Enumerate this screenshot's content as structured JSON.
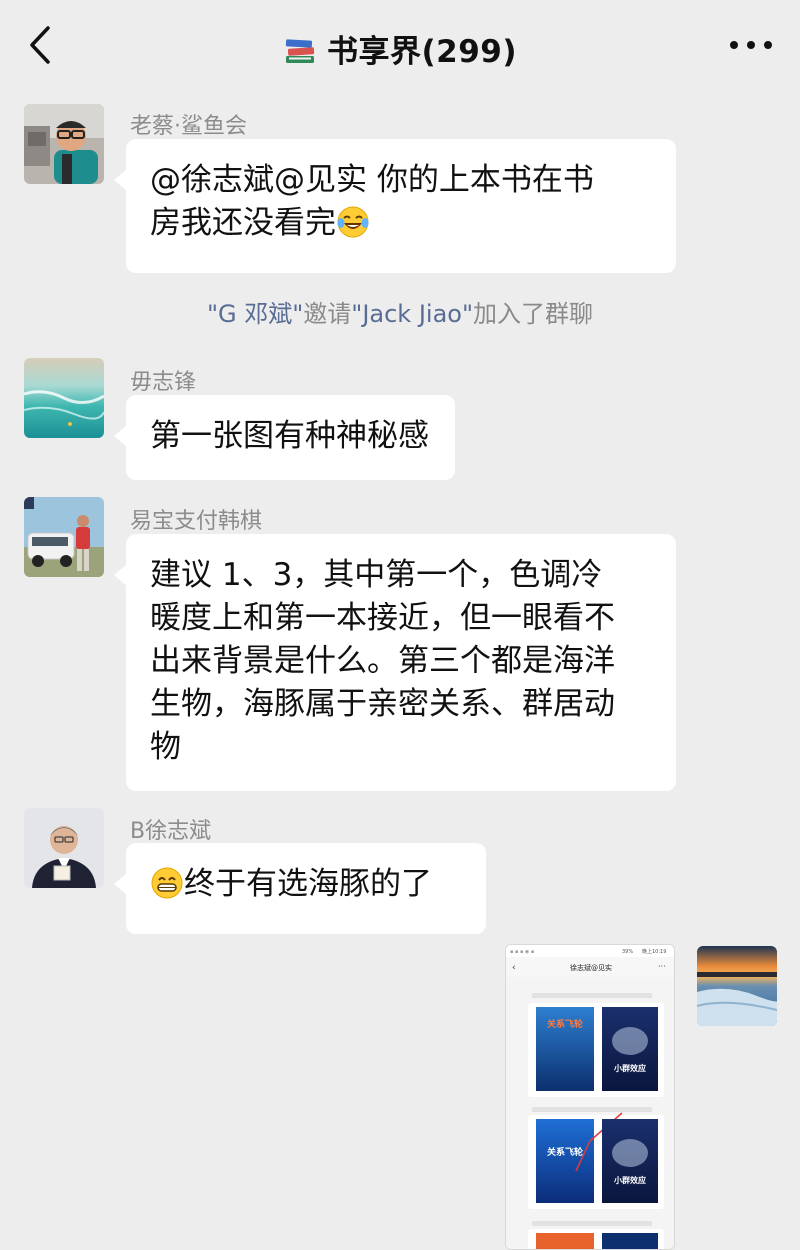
{
  "header": {
    "title": "书享界(299)",
    "back_icon": "chevron-left-icon",
    "book_icon": "books-icon",
    "more_icon": "more-dots-icon"
  },
  "messages": [
    {
      "sender": "老蔡·鲨鱼会",
      "lines": [
        "@徐志斌@见实  你的上本书在书",
        "房我还没看完"
      ],
      "emoji": "tears-of-joy-emoji"
    },
    {
      "sender": "毋志锋",
      "lines": [
        "第一张图有种神秘感"
      ]
    },
    {
      "sender": "易宝支付韩棋",
      "lines": [
        "建议 1、3，其中第一个，色调冷",
        "暖度上和第一本接近，但一眼看不",
        "出来背景是什么。第三个都是海洋",
        "生物，海豚属于亲密关系、群居动",
        "物"
      ]
    },
    {
      "sender": "B徐志斌",
      "text": "终于有选海豚的了",
      "emoji": "grinning-emoji"
    }
  ],
  "system_message": {
    "inviter": "\"G 邓斌\"",
    "verb": "邀请",
    "invitee": "\"Jack Jiao\"",
    "suffix": "加入了群聊"
  },
  "image_message": {
    "phone_header_title": "徐志斌@见实",
    "status_time": "晚上10:19",
    "status_battery": "39%",
    "cover_titles": [
      "关系飞轮",
      "小群效应",
      "关系飞轮",
      "小群效应"
    ]
  },
  "colors": {
    "background": "#ededed",
    "bubble": "#ffffff",
    "sender_name": "#8c8c8c",
    "system_name": "#586c94"
  }
}
